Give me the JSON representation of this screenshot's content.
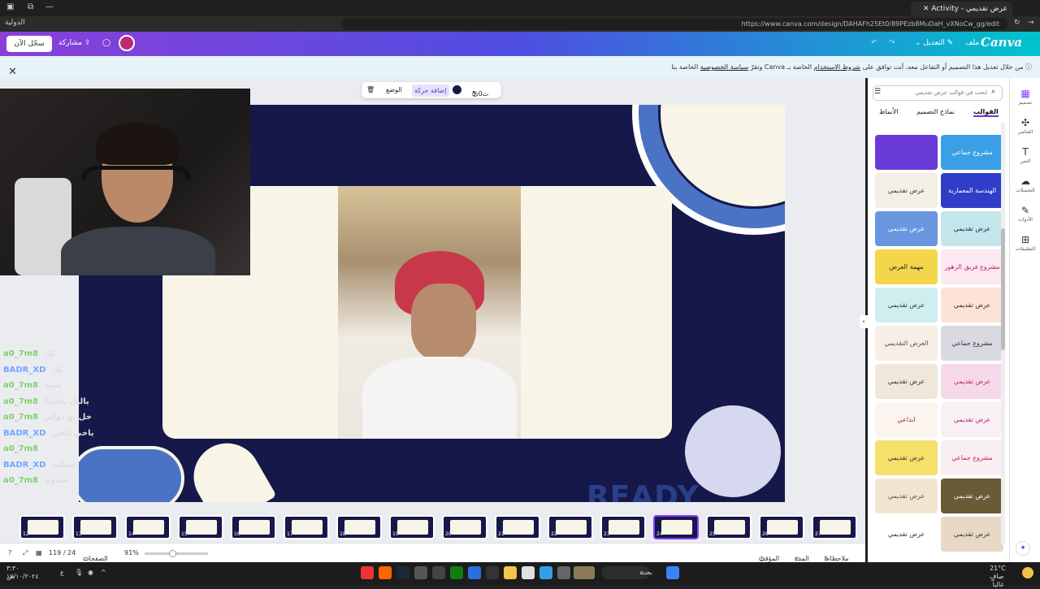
{
  "browser": {
    "tab_title": "عرض تقديمي - Activity",
    "url": "https://www.canva.com/design/DAHAFh25Et0/89PEzb8MuDaH_vXNoCw_gg/edit",
    "bookmark": "الدولية"
  },
  "header": {
    "logo": "Canva",
    "file_menu": "ملف",
    "edit_menu": "التعديل",
    "share_label": "مشاركة",
    "signin_label": "سجّل الآن"
  },
  "notice": {
    "text_pre": "من خلال تعديل هذا التصميم أو التفاعل معه، أنت توافق على",
    "terms_link": "شروط الاستخدام",
    "text_mid": "الخاصة بـ Canva وتقرّ",
    "privacy_link": "سياسة الخصوصية",
    "text_post": "الخاصة بنا"
  },
  "toolbar": {
    "duration": "5.0ث",
    "add_animation": "إضافة حركة",
    "position": "الوضع"
  },
  "slide": {
    "ready_text": "READY"
  },
  "chat": [
    {
      "user": "a0_7m8",
      "msg": "ئك"
    },
    {
      "user": "BADR_XD",
      "msg": "ئك"
    },
    {
      "user": "a0_7m8",
      "msg": "مننة"
    },
    {
      "user": "a0_7m8",
      "msg": "ياليل نخلتنا"
    },
    {
      "user": "a0_7m8",
      "msg": "خل بو دواير"
    },
    {
      "user": "BADR_XD",
      "msg": "ياخي ابغى"
    },
    {
      "user": "a0_7m8",
      "msg": ""
    },
    {
      "user": "BADR_XD",
      "msg": "سياب"
    },
    {
      "user": "a0_7m8",
      "msg": "صدوج"
    }
  ],
  "panel": {
    "search_placeholder": "ابحث في قوالب عرض تقديمي",
    "tabs": [
      "القوالب",
      "نماذج التصميم",
      "الأنماط"
    ],
    "templates": [
      {
        "title": "مشروع جماعي",
        "bg": "#3aa0e6",
        "fg": "#fff"
      },
      {
        "title": "",
        "bg": "#6a3bd6",
        "fg": "#fff"
      },
      {
        "title": "الهندسة المعمارية والتصميم",
        "bg": "#2f3ec9",
        "fg": "#fff"
      },
      {
        "title": "عرض تقديمي",
        "bg": "#f4efe6",
        "fg": "#333"
      },
      {
        "title": "عرض تقديمي",
        "bg": "#c4e6ea",
        "fg": "#225"
      },
      {
        "title": "عرض تقديمي",
        "bg": "#6a96e0",
        "fg": "#fff"
      },
      {
        "title": "مشروع فريق الزهور",
        "bg": "#fbe8f0",
        "fg": "#c0266a"
      },
      {
        "title": "مهمة العرض",
        "bg": "#f3d64c",
        "fg": "#222"
      },
      {
        "title": "عرض تقديمي",
        "bg": "#fde2d8",
        "fg": "#333"
      },
      {
        "title": "عرض تقديمي",
        "bg": "#cfeef0",
        "fg": "#333"
      },
      {
        "title": "مشروع جماعي",
        "bg": "#d9d9e2",
        "fg": "#333"
      },
      {
        "title": "العرض التقديمي",
        "bg": "#f7efe6",
        "fg": "#555"
      },
      {
        "title": "عرض تقديمي",
        "bg": "#f6d9e8",
        "fg": "#c0266a"
      },
      {
        "title": "عرض تقديمي",
        "bg": "#efe7da",
        "fg": "#333"
      },
      {
        "title": "عرض تقديمي",
        "bg": "#f7f0f4",
        "fg": "#c0266a"
      },
      {
        "title": "ابداعي",
        "bg": "#fbf4ef",
        "fg": "#a03030"
      },
      {
        "title": "مشروع جماعي",
        "bg": "#f9eef2",
        "fg": "#c0266a"
      },
      {
        "title": "عرض تقديمي",
        "bg": "#f5e06a",
        "fg": "#333"
      },
      {
        "title": "عرض تقديمي",
        "bg": "#6b5a38",
        "fg": "#fff"
      },
      {
        "title": "عرض تقديمي",
        "bg": "#f2e6d0",
        "fg": "#555"
      },
      {
        "title": "عرض تقديمي",
        "bg": "#e7d9c6",
        "fg": "#333"
      },
      {
        "title": "عرض تقديمي",
        "bg": "#ffffff",
        "fg": "#333"
      }
    ]
  },
  "rail": [
    {
      "label": "تصميم",
      "icon": "design-icon",
      "glyph": "▦"
    },
    {
      "label": "العناصر",
      "icon": "elements-icon",
      "glyph": "✣"
    },
    {
      "label": "النص",
      "icon": "text-icon",
      "glyph": "T"
    },
    {
      "label": "التحميلات",
      "icon": "upload-icon",
      "glyph": "☁"
    },
    {
      "label": "الأدوات",
      "icon": "tools-icon",
      "glyph": "✎"
    },
    {
      "label": "التطبيقات",
      "icon": "apps-icon",
      "glyph": "⊞"
    }
  ],
  "filmstrip": {
    "pages": [
      "12",
      "13",
      "14",
      "15",
      "16",
      "17",
      "18",
      "19",
      "20",
      "21",
      "22",
      "23",
      "24",
      "25",
      "26",
      "27"
    ],
    "selected": "24"
  },
  "footer": {
    "notes": "ملاحظات",
    "duration": "المدة",
    "timer": "المؤقت",
    "zoom": "91%",
    "pages": "الصفحات",
    "page_count": "119 / 24"
  },
  "taskbar": {
    "search": "بحث",
    "weather": "21°C",
    "weather_desc": "صافٍ غالباً",
    "time": "٣:٣٠ ص",
    "date": "١٧/١٠/٢٠٢٤"
  },
  "colors": {
    "accent": "#8b3dff",
    "slide_navy": "#16184a",
    "slide_cream": "#f8f5e8",
    "slide_blue": "#4b73c4"
  }
}
